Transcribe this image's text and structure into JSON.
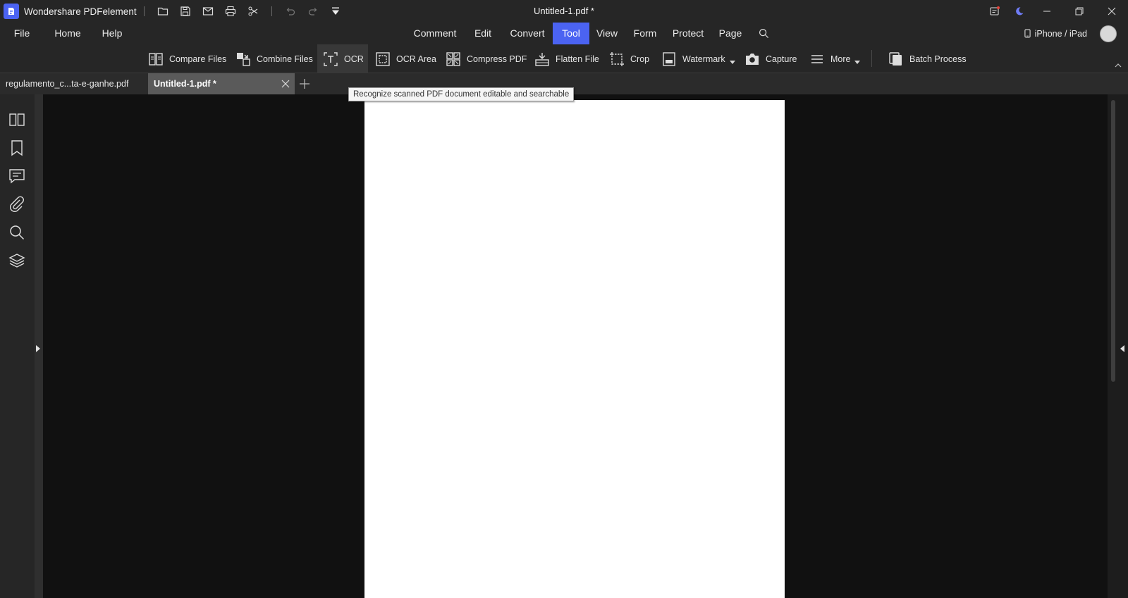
{
  "app": {
    "name": "Wondershare PDFelement",
    "document_title": "Untitled-1.pdf *"
  },
  "quick_access": {
    "icons": [
      "open-folder-icon",
      "save-icon",
      "email-icon",
      "print-icon",
      "scissors-icon",
      "undo-icon",
      "redo-icon",
      "customize-dropdown-icon"
    ]
  },
  "menu": {
    "items": [
      {
        "label": "File"
      },
      {
        "label": "Home"
      },
      {
        "label": "Help"
      },
      {
        "label": "Comment"
      },
      {
        "label": "Edit"
      },
      {
        "label": "Convert"
      },
      {
        "label": "Tool",
        "active": true
      },
      {
        "label": "View"
      },
      {
        "label": "Form"
      },
      {
        "label": "Protect"
      },
      {
        "label": "Page"
      }
    ],
    "search_icon": "search-icon",
    "device_label": "iPhone / iPad",
    "accent_color": "#4b63f2"
  },
  "toolbar": {
    "tools": [
      {
        "label": "Compare Files",
        "icon": "compare-files-icon"
      },
      {
        "label": "Combine Files",
        "icon": "combine-files-icon"
      },
      {
        "label": "OCR",
        "icon": "ocr-icon",
        "hovered": true
      },
      {
        "label": "OCR Area",
        "icon": "ocr-area-icon"
      },
      {
        "label": "Compress PDF",
        "icon": "compress-pdf-icon"
      },
      {
        "label": "Flatten File",
        "icon": "flatten-file-icon"
      },
      {
        "label": "Crop",
        "icon": "crop-icon"
      },
      {
        "label": "Watermark",
        "icon": "watermark-icon",
        "dropdown": true
      },
      {
        "label": "Capture",
        "icon": "camera-icon"
      },
      {
        "label": "More",
        "icon": "menu-lines-icon",
        "dropdown": true
      },
      {
        "label": "Batch Process",
        "icon": "batch-process-icon"
      }
    ]
  },
  "tabs": {
    "items": [
      {
        "label": "regulamento_c...ta-e-ganhe.pdf",
        "active": false
      },
      {
        "label": "Untitled-1.pdf *",
        "active": true
      }
    ]
  },
  "tooltip": {
    "text": "Recognize scanned PDF document editable and searchable"
  },
  "sidebar": {
    "icons": [
      "thumbnails-icon",
      "bookmark-icon",
      "comment-icon",
      "attachment-icon",
      "search-icon",
      "layers-icon"
    ]
  }
}
